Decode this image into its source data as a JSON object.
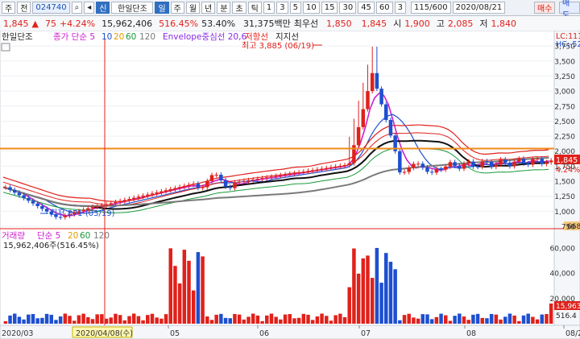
{
  "toolbar": {
    "menu_left": "주",
    "arrow1": "▾",
    "mode": "전",
    "code": "024740",
    "search_icon": "⌕",
    "nav_icon": "◂",
    "market_badge": "신",
    "stock_name": "한일단조",
    "periods": [
      "일",
      "주",
      "월",
      "년",
      "분",
      "초",
      "틱"
    ],
    "intervals": [
      "1",
      "3",
      "5",
      "10",
      "15",
      "30",
      "45",
      "60",
      "3"
    ],
    "page_counter": "115/600",
    "date": "2020/08/21",
    "buy_label": "매수",
    "sell_label": "매도"
  },
  "quote": {
    "price": "1,845",
    "change_symbol": "▲",
    "change": "75",
    "change_pct": "+4.24%",
    "volume": "15,962,406",
    "vol_ratio": "516.45%",
    "turnover_rate": "53.40%",
    "trade_value": "31,375백만",
    "best_ask_label": "최우선",
    "best_ask": "1,850",
    "best_bid": "1,845",
    "open_label": "시",
    "open": "1,900",
    "high_label": "고",
    "high": "2,085",
    "low_label": "저",
    "low": "1,840"
  },
  "price_panel": {
    "legend_name": "한일단조",
    "legend_ma_label": "종가 단순 5",
    "legend_ma_values": [
      "10",
      "20",
      "60",
      "120"
    ],
    "legend_env": "Envelope중심선 20,6",
    "legend_resist": "저항선",
    "legend_support": "지지선",
    "high_annotation": "최고 3,885 (06/19)",
    "low_annotation": "최저 871 (03/19)",
    "right_top": "LC:111",
    "right_top2": "HC:-52",
    "last_price_tag": "1,845",
    "last_pct_tag": "4.24%",
    "bottom_right_value": "668"
  },
  "volume_panel": {
    "legend_label": "거래량",
    "legend_ma_label": "단순 5",
    "legend_ma_values": [
      "20",
      "60",
      "120"
    ],
    "volume_text": "15,962,406주(516.45%)",
    "last_tag": "15,963",
    "last_pct_tag": "516.4"
  },
  "colors": {
    "up": "#e0211b",
    "down": "#1d4fd0",
    "ma5": "#cc22cc",
    "ma10": "#1d4fd0",
    "ma20": "#e39b00",
    "ma60": "#1a9a3a",
    "ma120": "#7a7a7a",
    "resist": "#f08a1c",
    "crosshair": "#e0211b"
  },
  "chart_data": [
    {
      "type": "candlestick",
      "title": "한일단조",
      "y_ticks": [
        750,
        1000,
        1250,
        1500,
        1750,
        2000,
        2250,
        2500,
        2750,
        3000,
        3250,
        3500,
        3750
      ],
      "y_range": [
        750,
        3900
      ],
      "x_labels": [
        "2020/03",
        "2020/04/08(수)",
        "05",
        "06",
        "07",
        "08",
        "08/21"
      ],
      "resistance_level": 2050,
      "high": {
        "value": 3885,
        "date": "06/19"
      },
      "low": {
        "value": 871,
        "date": "03/19"
      },
      "last_close": 1845
    },
    {
      "type": "bar",
      "title": "거래량",
      "y_ticks": [
        20000,
        40000,
        60000
      ],
      "unit": "천주",
      "last_value": 15962406
    }
  ]
}
